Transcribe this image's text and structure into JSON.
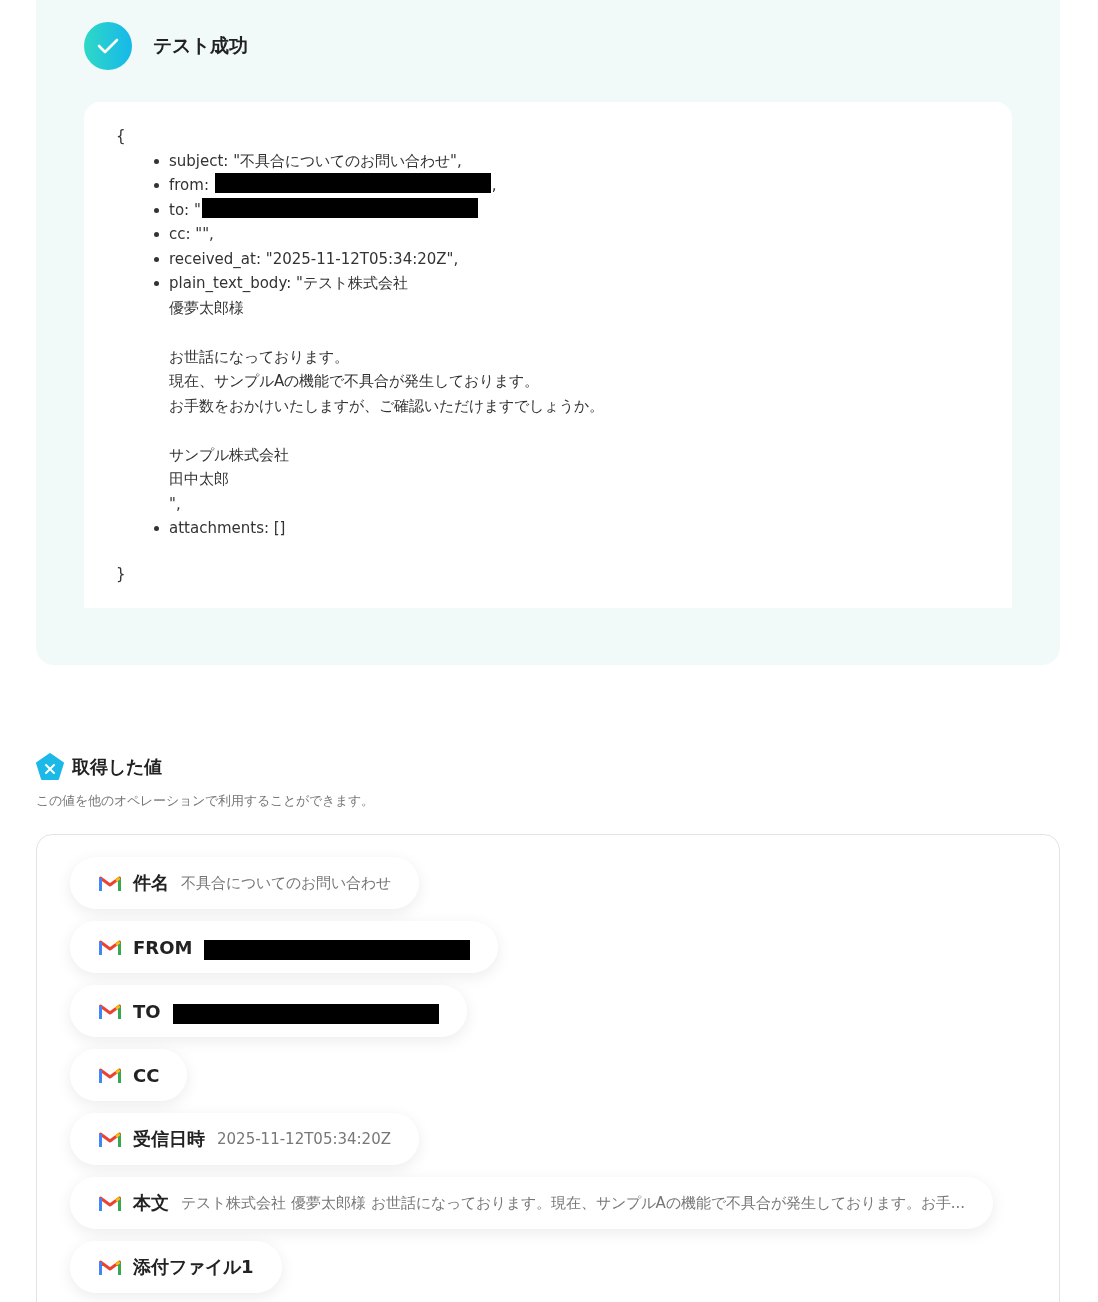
{
  "result": {
    "title": "テスト成功",
    "open_brace": "{",
    "close_brace": "}",
    "fields": [
      {
        "text": "subject: \"不具合についてのお問い合わせ\","
      },
      {
        "text": "from: ",
        "redacted": true,
        "after": ","
      },
      {
        "text": "to: \"",
        "redacted": true
      },
      {
        "text": "cc: \"\","
      },
      {
        "text": "received_at: \"2025-11-12T05:34:20Z\","
      },
      {
        "paragraphs": [
          [
            "plain_text_body: \"テスト株式会社",
            "優夢太郎様"
          ],
          [
            "お世話になっております。",
            "現在、サンプルAの機能で不具合が発生しております。",
            "お手数をおかけいたしますが、ご確認いただけますでしょうか。"
          ],
          [
            "サンプル株式会社",
            "田中太郎",
            "\","
          ]
        ]
      },
      {
        "text": "attachments: []"
      }
    ]
  },
  "values": {
    "title": "取得した値",
    "description": "この値を他のオペレーションで利用することができます。",
    "chips": [
      {
        "label": "件名",
        "value": "不具合についてのお問い合わせ"
      },
      {
        "label": "FROM",
        "redacted": true
      },
      {
        "label": "TO",
        "redacted": true
      },
      {
        "label": "CC"
      },
      {
        "label": "受信日時",
        "value": "2025-11-12T05:34:20Z"
      },
      {
        "label": "本文",
        "value": "テスト株式会社 優夢太郎様 お世話になっております。現在、サンプルAの機能で不具合が発生しております。お手..."
      },
      {
        "label": "添付ファイル1"
      }
    ]
  }
}
